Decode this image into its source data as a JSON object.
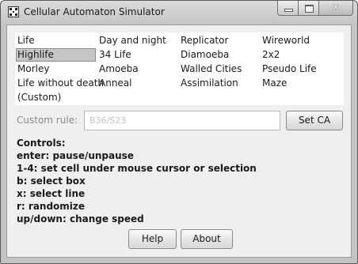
{
  "window": {
    "title": "Cellular Automaton Simulator",
    "close_glyph": "✕"
  },
  "rules": {
    "items": [
      {
        "label": "Life",
        "selected": false
      },
      {
        "label": "Day and night",
        "selected": false
      },
      {
        "label": "Replicator",
        "selected": false
      },
      {
        "label": "Wireworld",
        "selected": false
      },
      {
        "label": "Highlife",
        "selected": true
      },
      {
        "label": "34 Life",
        "selected": false
      },
      {
        "label": "Diamoeba",
        "selected": false
      },
      {
        "label": "2x2",
        "selected": false
      },
      {
        "label": "Morley",
        "selected": false
      },
      {
        "label": "Amoeba",
        "selected": false
      },
      {
        "label": "Walled Cities",
        "selected": false
      },
      {
        "label": "Pseudo Life",
        "selected": false
      },
      {
        "label": "Life without death",
        "selected": false
      },
      {
        "label": "Anneal",
        "selected": false
      },
      {
        "label": "Assimilation",
        "selected": false
      },
      {
        "label": "Maze",
        "selected": false
      },
      {
        "label": "(Custom)",
        "selected": false
      }
    ]
  },
  "custom_rule": {
    "label": "Custom rule:",
    "value": "",
    "placeholder": "B36/S23",
    "set_button_label": "Set CA"
  },
  "controls": {
    "heading": "Controls:",
    "lines": [
      "enter: pause/unpause",
      "1-4: set cell under mouse cursor or selection",
      "b: select box",
      "x: select line",
      "r: randomize",
      "up/down: change speed"
    ]
  },
  "footer": {
    "help_label": "Help",
    "about_label": "About"
  }
}
